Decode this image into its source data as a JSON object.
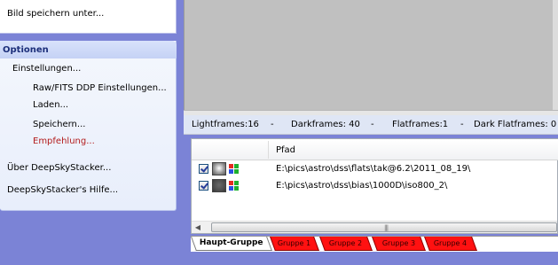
{
  "sidebar": {
    "save_as": "Bild speichern unter...",
    "options": {
      "title": "Optionen",
      "settings": "Einstellungen...",
      "raw_fits": "Raw/FITS DDP Einstellungen...",
      "load": "Laden...",
      "save": "Speichern...",
      "recommendation": "Empfehlung...",
      "about": "Über DeepSkyStacker...",
      "help": "DeepSkyStacker's Hilfe..."
    }
  },
  "status": {
    "lightframes": "Lightframes:16",
    "sep": "-",
    "darkframes": "Darkframes: 40",
    "flatframes": "Flatframes:1",
    "darkflat": "Dark Flatframes: 0"
  },
  "list": {
    "column_path": "Pfad",
    "rows": [
      {
        "path": "E:\\pics\\astro\\dss\\flats\\tak@6.2\\2011_08_19\\"
      },
      {
        "path": "E:\\pics\\astro\\dss\\bias\\1000D\\iso800_2\\"
      }
    ],
    "scroll_left": "◀",
    "scroll_grip": "|||"
  },
  "tabs": [
    "Haupt-Gruppe",
    "Gruppe 1",
    "Gruppe 2",
    "Gruppe 3",
    "Gruppe 4"
  ],
  "colors": {
    "sidebar_bg": "#7b83d6",
    "options_title": "#1c2f7a",
    "recommendation": "#b31c1c",
    "group_tab": "#ff1111"
  }
}
